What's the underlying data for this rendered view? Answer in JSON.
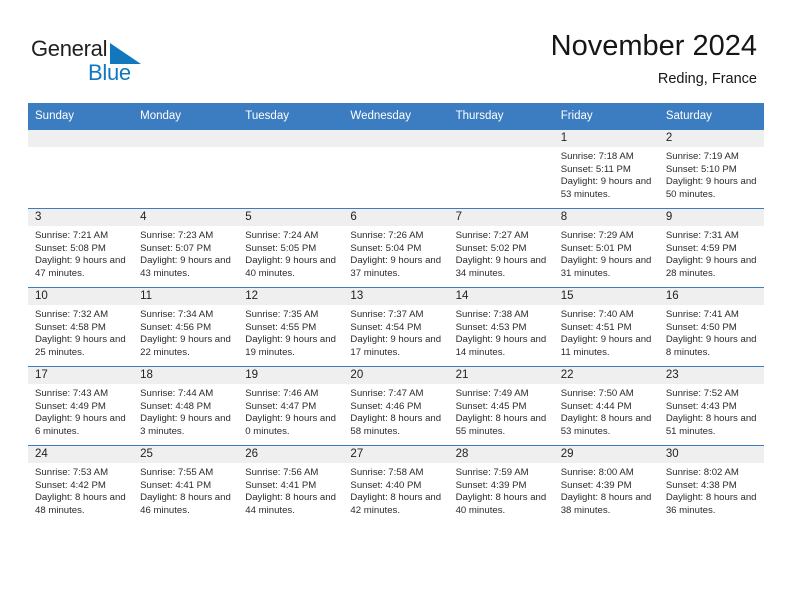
{
  "brand": {
    "name_part1": "General",
    "name_part2": "Blue",
    "accent_color": "#1278be"
  },
  "header": {
    "title": "November 2024",
    "subtitle": "Reding, France"
  },
  "theme": {
    "header_blue": "#3b7dc0",
    "daynum_band": "#efefef"
  },
  "weekdays": [
    "Sunday",
    "Monday",
    "Tuesday",
    "Wednesday",
    "Thursday",
    "Friday",
    "Saturday"
  ],
  "labels": {
    "sunrise": "Sunrise:",
    "sunset": "Sunset:",
    "daylight": "Daylight:"
  },
  "weeks": [
    [
      {
        "day": "",
        "empty": true
      },
      {
        "day": "",
        "empty": true
      },
      {
        "day": "",
        "empty": true
      },
      {
        "day": "",
        "empty": true
      },
      {
        "day": "",
        "empty": true
      },
      {
        "day": "1",
        "sunrise": "Sunrise: 7:18 AM",
        "sunset": "Sunset: 5:11 PM",
        "daylight": "Daylight: 9 hours and 53 minutes."
      },
      {
        "day": "2",
        "sunrise": "Sunrise: 7:19 AM",
        "sunset": "Sunset: 5:10 PM",
        "daylight": "Daylight: 9 hours and 50 minutes."
      }
    ],
    [
      {
        "day": "3",
        "sunrise": "Sunrise: 7:21 AM",
        "sunset": "Sunset: 5:08 PM",
        "daylight": "Daylight: 9 hours and 47 minutes."
      },
      {
        "day": "4",
        "sunrise": "Sunrise: 7:23 AM",
        "sunset": "Sunset: 5:07 PM",
        "daylight": "Daylight: 9 hours and 43 minutes."
      },
      {
        "day": "5",
        "sunrise": "Sunrise: 7:24 AM",
        "sunset": "Sunset: 5:05 PM",
        "daylight": "Daylight: 9 hours and 40 minutes."
      },
      {
        "day": "6",
        "sunrise": "Sunrise: 7:26 AM",
        "sunset": "Sunset: 5:04 PM",
        "daylight": "Daylight: 9 hours and 37 minutes."
      },
      {
        "day": "7",
        "sunrise": "Sunrise: 7:27 AM",
        "sunset": "Sunset: 5:02 PM",
        "daylight": "Daylight: 9 hours and 34 minutes."
      },
      {
        "day": "8",
        "sunrise": "Sunrise: 7:29 AM",
        "sunset": "Sunset: 5:01 PM",
        "daylight": "Daylight: 9 hours and 31 minutes."
      },
      {
        "day": "9",
        "sunrise": "Sunrise: 7:31 AM",
        "sunset": "Sunset: 4:59 PM",
        "daylight": "Daylight: 9 hours and 28 minutes."
      }
    ],
    [
      {
        "day": "10",
        "sunrise": "Sunrise: 7:32 AM",
        "sunset": "Sunset: 4:58 PM",
        "daylight": "Daylight: 9 hours and 25 minutes."
      },
      {
        "day": "11",
        "sunrise": "Sunrise: 7:34 AM",
        "sunset": "Sunset: 4:56 PM",
        "daylight": "Daylight: 9 hours and 22 minutes."
      },
      {
        "day": "12",
        "sunrise": "Sunrise: 7:35 AM",
        "sunset": "Sunset: 4:55 PM",
        "daylight": "Daylight: 9 hours and 19 minutes."
      },
      {
        "day": "13",
        "sunrise": "Sunrise: 7:37 AM",
        "sunset": "Sunset: 4:54 PM",
        "daylight": "Daylight: 9 hours and 17 minutes."
      },
      {
        "day": "14",
        "sunrise": "Sunrise: 7:38 AM",
        "sunset": "Sunset: 4:53 PM",
        "daylight": "Daylight: 9 hours and 14 minutes."
      },
      {
        "day": "15",
        "sunrise": "Sunrise: 7:40 AM",
        "sunset": "Sunset: 4:51 PM",
        "daylight": "Daylight: 9 hours and 11 minutes."
      },
      {
        "day": "16",
        "sunrise": "Sunrise: 7:41 AM",
        "sunset": "Sunset: 4:50 PM",
        "daylight": "Daylight: 9 hours and 8 minutes."
      }
    ],
    [
      {
        "day": "17",
        "sunrise": "Sunrise: 7:43 AM",
        "sunset": "Sunset: 4:49 PM",
        "daylight": "Daylight: 9 hours and 6 minutes."
      },
      {
        "day": "18",
        "sunrise": "Sunrise: 7:44 AM",
        "sunset": "Sunset: 4:48 PM",
        "daylight": "Daylight: 9 hours and 3 minutes."
      },
      {
        "day": "19",
        "sunrise": "Sunrise: 7:46 AM",
        "sunset": "Sunset: 4:47 PM",
        "daylight": "Daylight: 9 hours and 0 minutes."
      },
      {
        "day": "20",
        "sunrise": "Sunrise: 7:47 AM",
        "sunset": "Sunset: 4:46 PM",
        "daylight": "Daylight: 8 hours and 58 minutes."
      },
      {
        "day": "21",
        "sunrise": "Sunrise: 7:49 AM",
        "sunset": "Sunset: 4:45 PM",
        "daylight": "Daylight: 8 hours and 55 minutes."
      },
      {
        "day": "22",
        "sunrise": "Sunrise: 7:50 AM",
        "sunset": "Sunset: 4:44 PM",
        "daylight": "Daylight: 8 hours and 53 minutes."
      },
      {
        "day": "23",
        "sunrise": "Sunrise: 7:52 AM",
        "sunset": "Sunset: 4:43 PM",
        "daylight": "Daylight: 8 hours and 51 minutes."
      }
    ],
    [
      {
        "day": "24",
        "sunrise": "Sunrise: 7:53 AM",
        "sunset": "Sunset: 4:42 PM",
        "daylight": "Daylight: 8 hours and 48 minutes."
      },
      {
        "day": "25",
        "sunrise": "Sunrise: 7:55 AM",
        "sunset": "Sunset: 4:41 PM",
        "daylight": "Daylight: 8 hours and 46 minutes."
      },
      {
        "day": "26",
        "sunrise": "Sunrise: 7:56 AM",
        "sunset": "Sunset: 4:41 PM",
        "daylight": "Daylight: 8 hours and 44 minutes."
      },
      {
        "day": "27",
        "sunrise": "Sunrise: 7:58 AM",
        "sunset": "Sunset: 4:40 PM",
        "daylight": "Daylight: 8 hours and 42 minutes."
      },
      {
        "day": "28",
        "sunrise": "Sunrise: 7:59 AM",
        "sunset": "Sunset: 4:39 PM",
        "daylight": "Daylight: 8 hours and 40 minutes."
      },
      {
        "day": "29",
        "sunrise": "Sunrise: 8:00 AM",
        "sunset": "Sunset: 4:39 PM",
        "daylight": "Daylight: 8 hours and 38 minutes."
      },
      {
        "day": "30",
        "sunrise": "Sunrise: 8:02 AM",
        "sunset": "Sunset: 4:38 PM",
        "daylight": "Daylight: 8 hours and 36 minutes."
      }
    ]
  ]
}
